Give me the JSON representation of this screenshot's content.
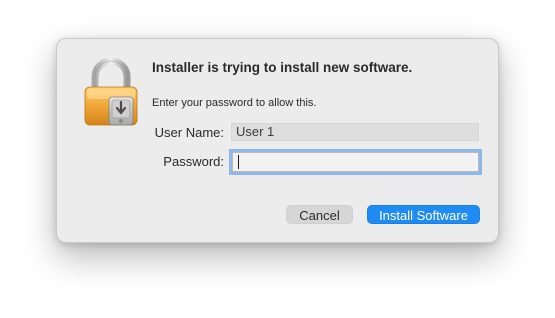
{
  "dialog": {
    "title": "Installer is trying to install new software.",
    "subtitle": "Enter your password to allow this.",
    "username_label": "User Name:",
    "username_value": "User 1",
    "password_label": "Password:",
    "password_value": "",
    "cancel_label": "Cancel",
    "install_label": "Install Software",
    "icon": "lock-icon"
  },
  "colors": {
    "dialog_bg": "#ececec",
    "accent": "#1f8bf5",
    "focus_ring": "#8fb8ea",
    "lock_gold": "#f0a52a",
    "lock_silver": "#c9c9c9"
  }
}
